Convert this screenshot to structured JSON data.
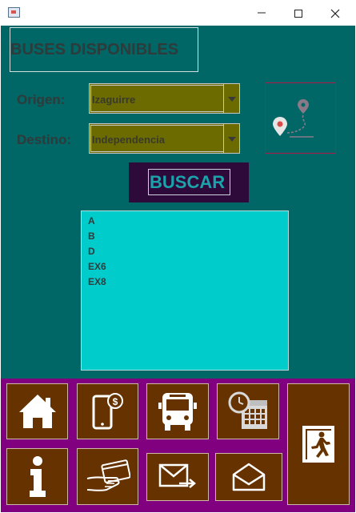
{
  "window": {
    "icon": "java-app-icon"
  },
  "header": {
    "title": "BUSES DISPONIBLES"
  },
  "form": {
    "origin_label": "Origen:",
    "origin_value": "Izaguirre",
    "destination_label": "Destino:",
    "destination_value": "Independencia",
    "search_label": "BUSCAR",
    "map_icon": "map-route-icon"
  },
  "results": [
    "A",
    "B",
    "D",
    "EX6",
    "EX8"
  ],
  "nav": {
    "icons": [
      "home-icon",
      "mobile-payment-icon",
      "bus-icon",
      "schedule-calendar-icon",
      "exit-icon",
      "info-icon",
      "card-payment-icon",
      "send-mail-icon",
      "open-mail-icon"
    ]
  },
  "colors": {
    "main_bg": "#006666",
    "combo_bg": "#6b6b00",
    "list_bg": "#00cccc",
    "button_bg": "#2e0a3a",
    "nav_bg": "#800080",
    "tile_bg": "#663300"
  }
}
